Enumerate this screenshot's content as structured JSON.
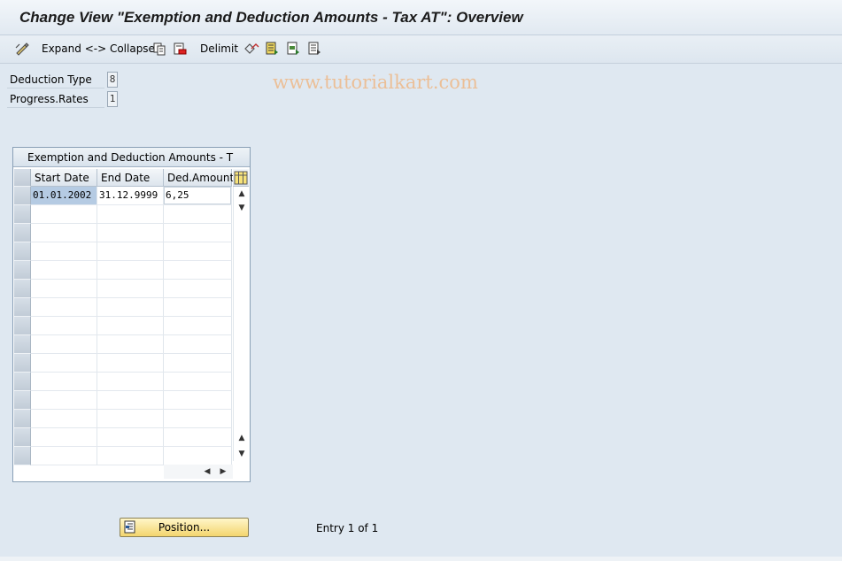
{
  "window": {
    "title": "Change View \"Exemption and Deduction Amounts - Tax AT\": Overview"
  },
  "toolbar": {
    "items": [
      {
        "label": "",
        "icon": "edit-pencil-icon"
      },
      {
        "label": "Expand <-> Collapse",
        "icon": ""
      },
      {
        "label": "",
        "icon": "copy-icon"
      },
      {
        "label": "",
        "icon": "delete-icon"
      },
      {
        "label": "Delimit",
        "icon": ""
      },
      {
        "label": "",
        "icon": "undo-icon"
      },
      {
        "label": "",
        "icon": "select-all-icon"
      },
      {
        "label": "",
        "icon": "select-block-icon"
      },
      {
        "label": "",
        "icon": "deselect-all-icon"
      }
    ],
    "watermark": "www.tutorialkart.com"
  },
  "fields": [
    {
      "label": "Deduction Type",
      "value": "8"
    },
    {
      "label": "Progress.Rates",
      "value": "1"
    }
  ],
  "table": {
    "title": "Exemption and Deduction Amounts - T",
    "columns": [
      "Start Date",
      "End Date",
      "Ded.Amount"
    ],
    "rows": [
      [
        "01.01.2002",
        "31.12.9999",
        "6,25"
      ]
    ],
    "visible_row_count": 15,
    "config_icon": "table-settings-icon"
  },
  "footer": {
    "position_button": "Position...",
    "entry_text": "Entry 1 of 1"
  }
}
